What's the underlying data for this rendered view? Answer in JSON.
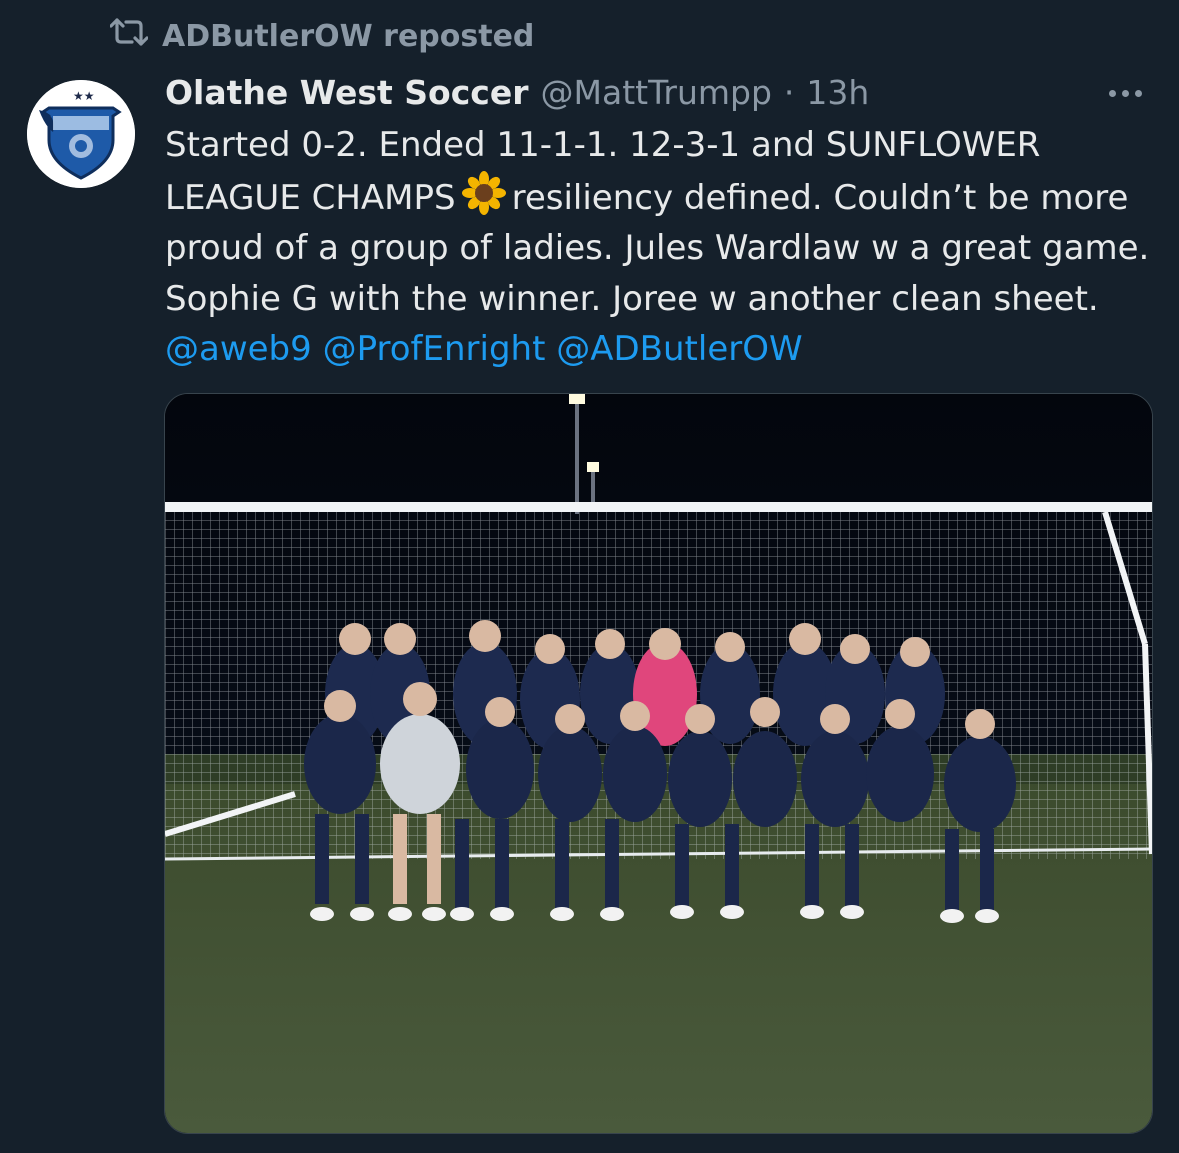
{
  "repost": {
    "icon": "repost-icon",
    "label": "ADButlerOW reposted"
  },
  "tweet": {
    "avatar_icon": "olathe-west-owls-logo",
    "display_name": "Olathe West Soccer",
    "handle": "@MattTrumpp",
    "separator": "·",
    "time": "13h",
    "text_part1": "Started 0-2. Ended 11-1-1. 12-3-1 and SUNFLOWER LEAGUE CHAMPS",
    "emoji_icon": "sunflower-emoji",
    "text_part2": "resiliency defined. Couldn’t be more proud of a group of ladies. Jules Wardlaw w a great game. Sophie G with the winner. Joree w another clean sheet.",
    "mentions": [
      "@aweb9",
      "@ProfEnright",
      "@ADButlerOW"
    ],
    "more_icon": "more-options-icon",
    "media_description_icon": "team-photo-image"
  },
  "colors": {
    "background": "#15202b",
    "text": "#e7e9ea",
    "secondary": "#8b98a5",
    "link": "#1d9bf0"
  }
}
